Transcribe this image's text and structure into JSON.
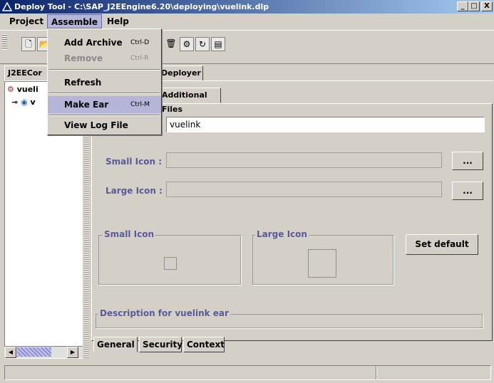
{
  "window": {
    "title": "Deploy Tool - C:\\SAP_J2EEngine6.20\\deploying\\vuelink.dlp",
    "min": "_",
    "max": "□",
    "close": "X"
  },
  "menubar": {
    "project": "Project",
    "assemble": "Assemble",
    "help": "Help"
  },
  "toolbar": {
    "icons": [
      "new-file-icon",
      "open-folder-icon",
      "delete-icon",
      "deploy-icon",
      "refresh-icon",
      "document-icon"
    ]
  },
  "top_tabs": {
    "j2ee": "J2EECor",
    "deployer": "Deployer"
  },
  "tree": {
    "root_label": "vueli",
    "child_label": "v"
  },
  "inner_tabs": {
    "additional_files": "Additional Files"
  },
  "form": {
    "name_value": "vuelink",
    "small_icon_label": "Small Icon :",
    "large_icon_label": "Large Icon :",
    "browse_label": "...",
    "small_icon_group": "Small Icon",
    "large_icon_group": "Large Icon",
    "set_default": "Set default",
    "description_group": "Description for  vuelink ear"
  },
  "bottom_tabs": {
    "general": "General",
    "security": "Security",
    "context": "Context"
  },
  "assemble_menu": {
    "add_archive": "Add Archive",
    "add_archive_sc": "Ctrl-D",
    "remove": "Remove",
    "remove_sc": "Ctrl-R",
    "refresh": "Refresh",
    "make_ear": "Make Ear",
    "make_ear_sc": "Ctrl-M",
    "view_log": "View Log File"
  },
  "colors": {
    "title_start": "#0a246a",
    "title_end": "#a6caf0",
    "highlight": "#b5b5d9",
    "label": "#5a5a9a"
  }
}
